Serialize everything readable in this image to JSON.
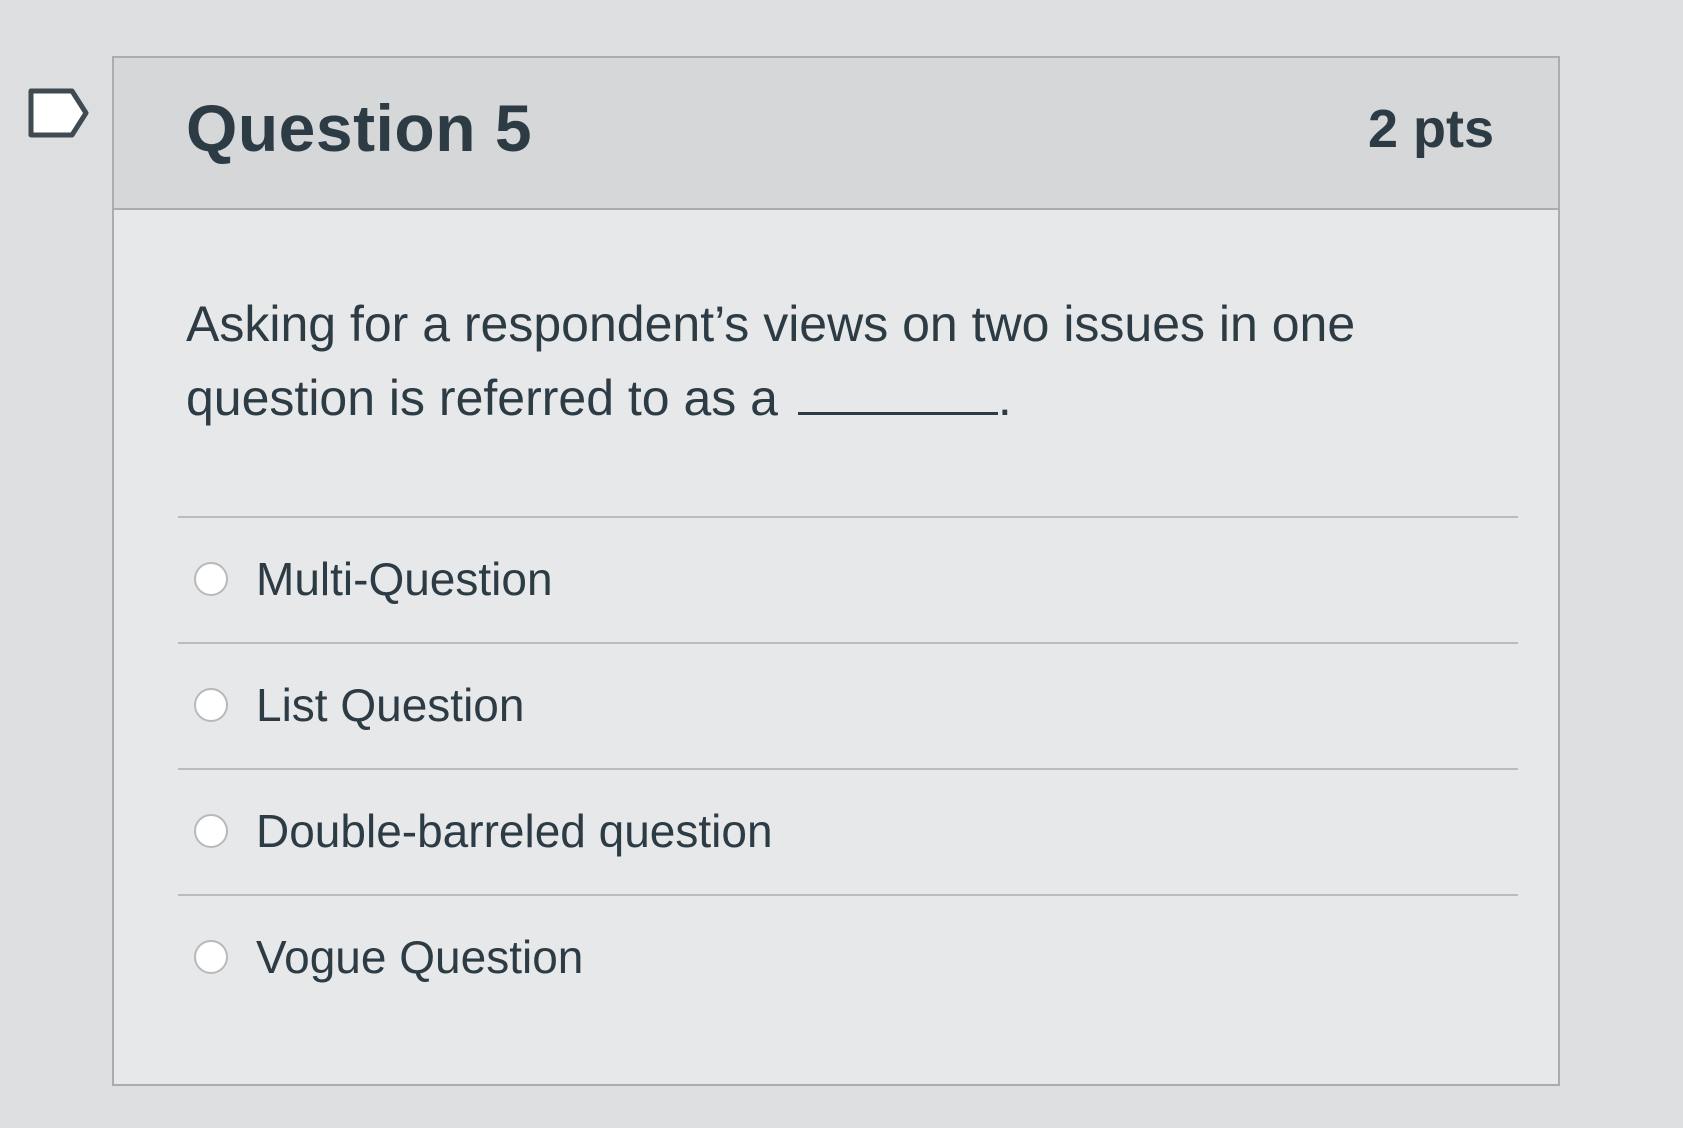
{
  "question": {
    "title": "Question 5",
    "points": "2 pts",
    "text": "Asking for a respondent’s views on two issues in one question is referred to as a",
    "text_end": ".",
    "flag_icon": "bookmark-flag-icon"
  },
  "answers": [
    {
      "label": "Multi-Question",
      "selected": false
    },
    {
      "label": "List Question",
      "selected": false
    },
    {
      "label": "Double-barreled question",
      "selected": false
    },
    {
      "label": "Vogue Question",
      "selected": false
    }
  ],
  "colors": {
    "text": "#2d3b45",
    "header_bg": "#d5d7d8",
    "card_bg": "#e6e8e9",
    "border": "#a9adb0"
  }
}
